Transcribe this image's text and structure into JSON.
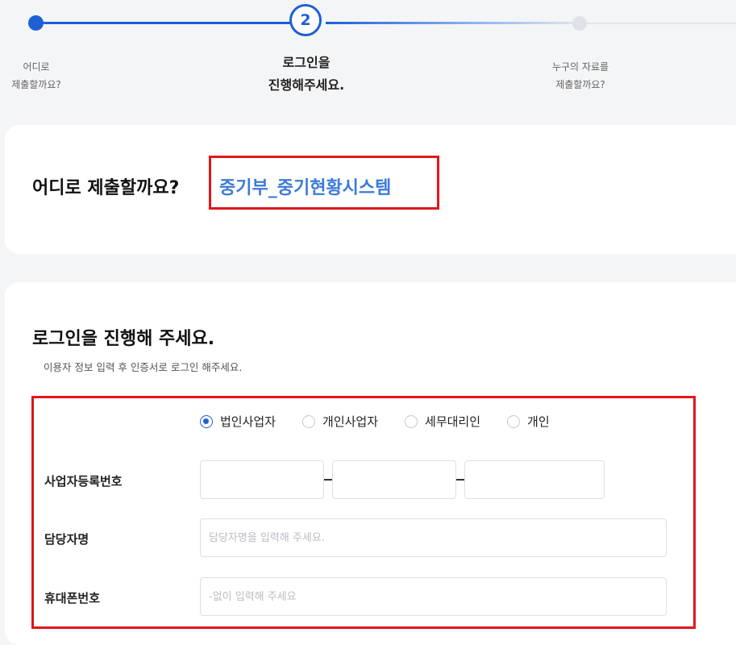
{
  "stepper": {
    "steps": [
      {
        "label": "어디로\n제출할까요?"
      },
      {
        "number": "2",
        "label": "로그인을\n진행해주세요."
      },
      {
        "label": "누구의 자료를\n제출할까요?"
      }
    ]
  },
  "submit_card": {
    "question": "어디로 제출할까요?",
    "target": "중기부_중기현황시스템"
  },
  "login_card": {
    "title": "로그인을 진행해 주세요.",
    "subtitle": "이용자 정보 입력 후 인증서로 로그인 해주세요.",
    "user_types": [
      {
        "label": "법인사업자",
        "selected": true
      },
      {
        "label": "개인사업자",
        "selected": false
      },
      {
        "label": "세무대리인",
        "selected": false
      },
      {
        "label": "개인",
        "selected": false
      }
    ],
    "fields": {
      "business_number": {
        "label": "사업자등록번호",
        "part1": "",
        "part2": "",
        "part3": ""
      },
      "manager_name": {
        "label": "담당자명",
        "placeholder": "담당자명을 입력해 주세요.",
        "value": ""
      },
      "phone": {
        "label": "휴대폰번호",
        "placeholder": "-없이 입력해 주세요",
        "value": ""
      }
    }
  },
  "colors": {
    "accent": "#1f5fd6",
    "target_text": "#3c7ad8",
    "highlight_border": "#e1161c"
  }
}
